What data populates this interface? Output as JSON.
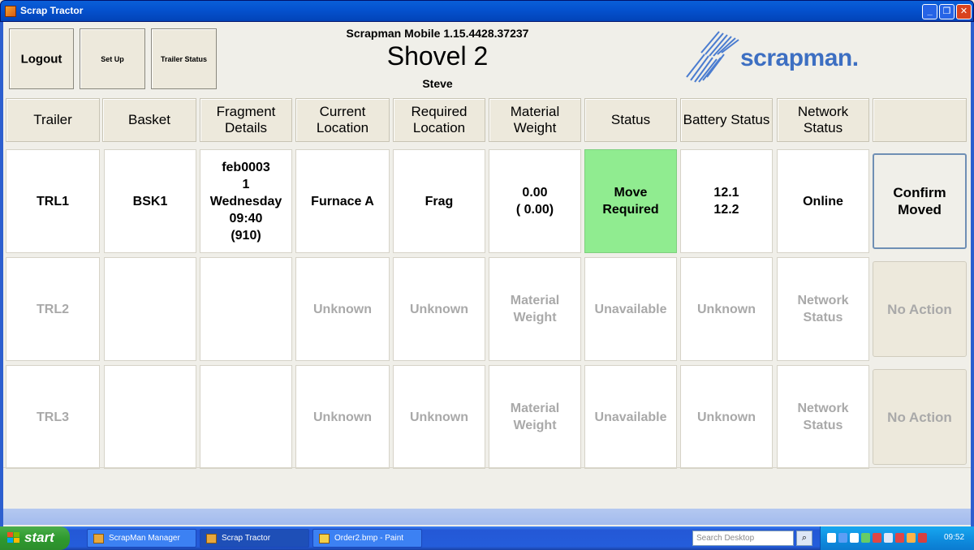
{
  "window": {
    "title": "Scrap Tractor",
    "icon": "app-icon"
  },
  "toolbar": {
    "logout": "Logout",
    "setup": "Set Up",
    "trailer_status": "Trailer Status"
  },
  "header": {
    "version": "Scrapman Mobile 1.15.4428.37237",
    "title": "Shovel 2",
    "operator": "Steve",
    "logo_text": "scrapman."
  },
  "columns": [
    "Trailer",
    "Basket",
    "Fragment Details",
    "Current Location",
    "Required Location",
    "Material Weight",
    "Status",
    "Battery Status",
    "Network Status"
  ],
  "rows": [
    {
      "trailer": "TRL1",
      "basket": "BSK1",
      "fragment": [
        "feb0003",
        "1",
        "Wednesday",
        "09:40",
        "(910)"
      ],
      "current_location": "Furnace A",
      "required_location": "Frag",
      "weight": [
        "0.00",
        "( 0.00)"
      ],
      "status": [
        "Move",
        "Required"
      ],
      "battery": [
        "12.1",
        "12.2"
      ],
      "network": "Online",
      "action": "Confirm Moved",
      "active": true
    },
    {
      "trailer": "TRL2",
      "basket": "",
      "fragment": [],
      "current_location": "Unknown",
      "required_location": "Unknown",
      "weight": [
        "Material",
        "Weight"
      ],
      "status": [
        "Unavailable"
      ],
      "battery": [
        "Unknown"
      ],
      "network": "Network Status",
      "action": "No Action",
      "active": false
    },
    {
      "trailer": "TRL3",
      "basket": "",
      "fragment": [],
      "current_location": "Unknown",
      "required_location": "Unknown",
      "weight": [
        "Material",
        "Weight"
      ],
      "status": [
        "Unavailable"
      ],
      "battery": [
        "Unknown"
      ],
      "network": "Network Status",
      "action": "No Action",
      "active": false
    }
  ],
  "colors": {
    "status_green": "#90ec90",
    "titlebar_blue": "#0553d0",
    "logo_blue": "#3d6fc2",
    "dim_text": "#a9a9a9"
  },
  "taskbar": {
    "start": "start",
    "tasks": [
      "ScrapMan Manager",
      "Scrap Tractor",
      "Order2.bmp - Paint"
    ],
    "search_placeholder": "Search Desktop",
    "clock": "09:52"
  }
}
